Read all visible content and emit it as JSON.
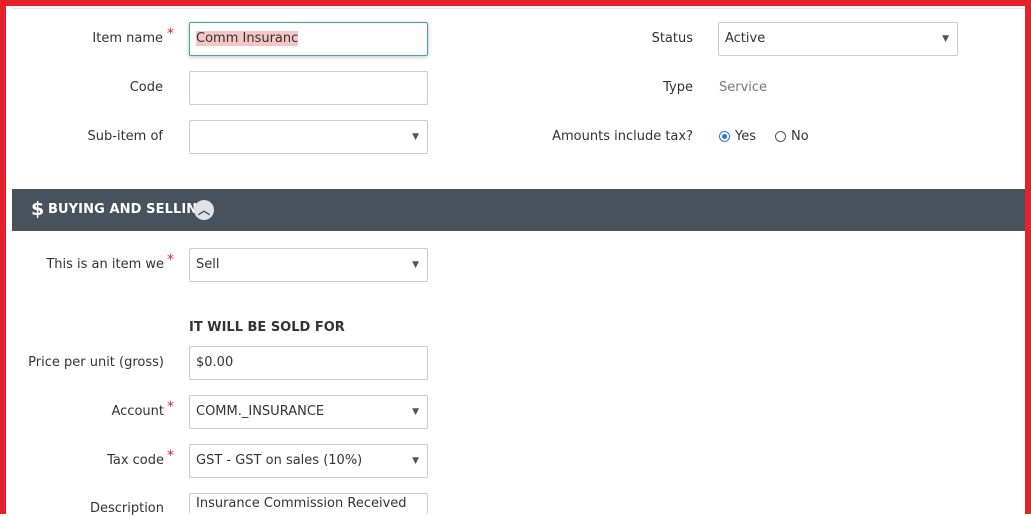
{
  "form": {
    "item_name": {
      "label": "Item name",
      "value": "Comm Insuranc"
    },
    "code": {
      "label": "Code",
      "value": ""
    },
    "sub_item_of": {
      "label": "Sub-item of",
      "value": ""
    },
    "status": {
      "label": "Status",
      "value": "Active"
    },
    "type": {
      "label": "Type",
      "value": "Service"
    },
    "amounts_include_tax": {
      "label": "Amounts include tax?",
      "yes": "Yes",
      "no": "No",
      "selected": "Yes"
    },
    "required_marker": "*"
  },
  "buying_selling": {
    "section_icon": "dollar-icon",
    "section_icon_glyph": "$",
    "title": "BUYING AND SELLING",
    "toggle_icon": "chevron-up-icon",
    "item_we": {
      "label": "This is an item we",
      "value": "Sell"
    },
    "subheading": "IT WILL BE SOLD FOR",
    "price": {
      "label": "Price per unit (gross)",
      "value": "$0.00"
    },
    "account": {
      "label": "Account",
      "value": "COMM._INSURANCE"
    },
    "tax_code": {
      "label": "Tax code",
      "value": "GST - GST on sales (10%)"
    },
    "description": {
      "label": "Description",
      "value": "Insurance Commission Received"
    }
  },
  "colors": {
    "frame": "#e8202a",
    "section_bg": "#48525c",
    "focus_border": "#3fa7a0",
    "required": "#e0262d",
    "radio_selected": "#2b7bd4"
  }
}
